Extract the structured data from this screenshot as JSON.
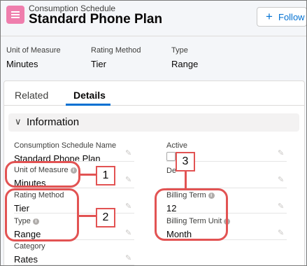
{
  "header": {
    "object_type": "Consumption Schedule",
    "record_name": "Standard Phone Plan",
    "follow_label": "Follow"
  },
  "highlights": [
    {
      "label": "Unit of Measure",
      "value": "Minutes"
    },
    {
      "label": "Rating Method",
      "value": "Tier"
    },
    {
      "label": "Type",
      "value": "Range"
    }
  ],
  "tabs": {
    "related": "Related",
    "details": "Details"
  },
  "section": {
    "title": "Information"
  },
  "fields": {
    "schedule_name": {
      "label": "Consumption Schedule Name",
      "value": "Standard Phone Plan"
    },
    "active": {
      "label": "Active"
    },
    "description": {
      "label": "De"
    },
    "unit_of_measure": {
      "label": "Unit of Measure",
      "value": "Minutes"
    },
    "rating_method": {
      "label": "Rating Method",
      "value": "Tier"
    },
    "type": {
      "label": "Type",
      "value": "Range"
    },
    "billing_term": {
      "label": "Billing Term",
      "value": "12"
    },
    "billing_term_unit": {
      "label": "Billing Term Unit",
      "value": "Month"
    },
    "category": {
      "label": "Category",
      "value": "Rates"
    }
  },
  "callouts": {
    "one": "1",
    "two": "2",
    "three": "3"
  },
  "colors": {
    "accent_blue": "#0070d2",
    "callout_red": "#e25353",
    "object_icon_pink": "#ef7ead"
  }
}
